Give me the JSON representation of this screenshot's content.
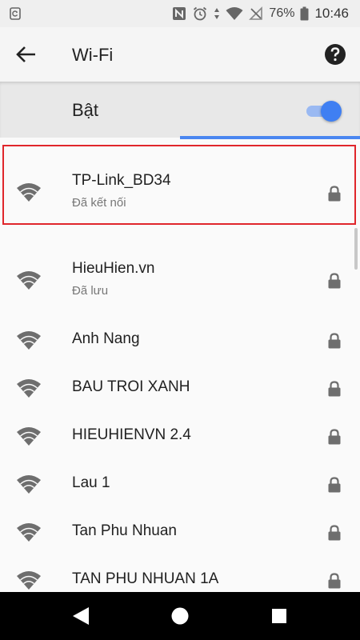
{
  "status_bar": {
    "battery_percent": "76%",
    "time": "10:46",
    "icons": [
      "screenshot-icon",
      "nfc-icon",
      "alarm-icon",
      "data-arrows-icon",
      "wifi-icon",
      "no-signal-icon",
      "battery-icon"
    ]
  },
  "app_bar": {
    "title": "Wi-Fi",
    "back_icon": "arrow-left-icon",
    "help_icon": "help-icon"
  },
  "wifi_toggle": {
    "label": "Bật",
    "enabled": true
  },
  "networks": [
    {
      "name": "TP-Link_BD34",
      "status": "Đã kết nối",
      "secured": true
    },
    {
      "name": "HieuHien.vn",
      "status": "Đã lưu",
      "secured": true
    },
    {
      "name": "Anh Nang",
      "status": "",
      "secured": true
    },
    {
      "name": "BAU TROI XANH",
      "status": "",
      "secured": true
    },
    {
      "name": "HIEUHIENVN 2.4",
      "status": "",
      "secured": true
    },
    {
      "name": "Lau 1",
      "status": "",
      "secured": true
    },
    {
      "name": "Tan Phu Nhuan",
      "status": "",
      "secured": true
    },
    {
      "name": "TAN PHU NHUAN 1A",
      "status": "",
      "secured": true
    }
  ],
  "colors": {
    "accent": "#3f7ff2",
    "highlight_border": "#e0262b",
    "icon_gray": "#6e6e6e"
  },
  "nav_bar": {
    "icons": [
      "back-triangle-icon",
      "home-circle-icon",
      "recents-square-icon"
    ]
  }
}
